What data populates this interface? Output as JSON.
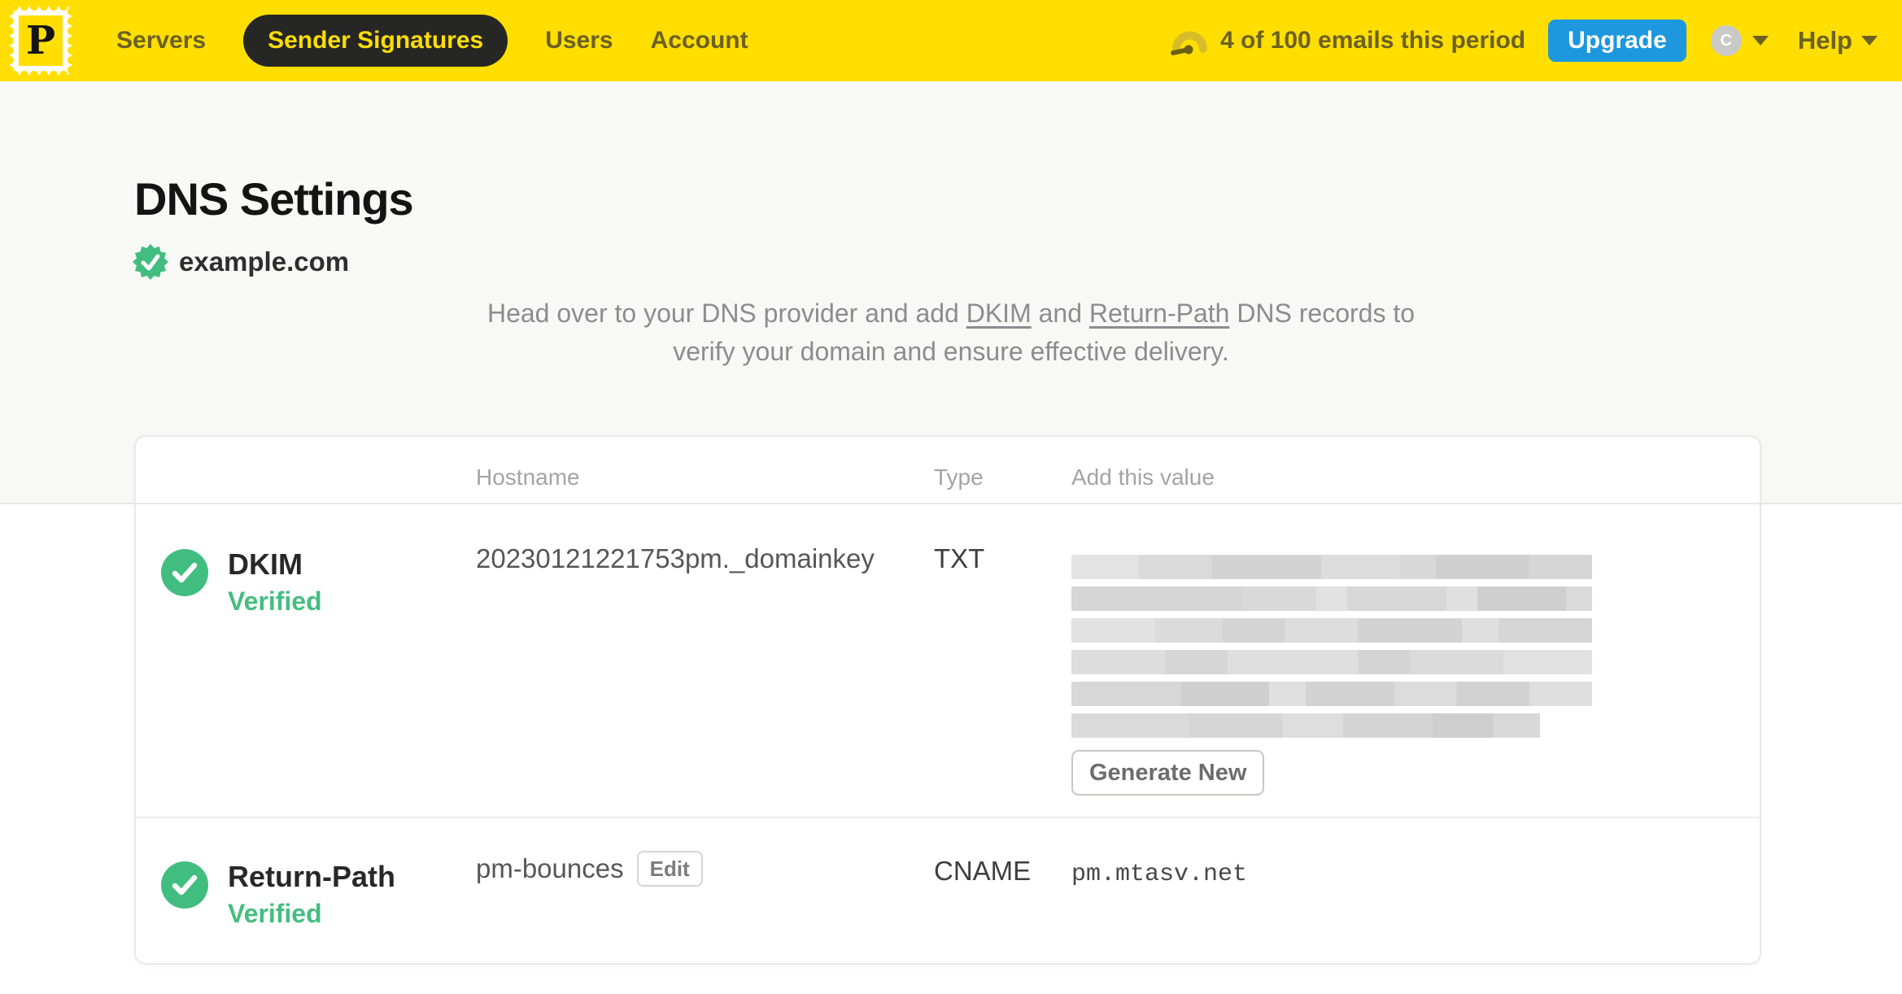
{
  "nav": {
    "logo_letter": "P",
    "items": [
      {
        "label": "Servers",
        "active": false
      },
      {
        "label": "Sender Signatures",
        "active": true
      },
      {
        "label": "Users",
        "active": false
      },
      {
        "label": "Account",
        "active": false
      }
    ],
    "usage_text": "4 of 100 emails this period",
    "upgrade_label": "Upgrade",
    "avatar_initial": "C",
    "help_label": "Help"
  },
  "page": {
    "title": "DNS Settings",
    "domain": "example.com",
    "intro": {
      "part1": "Head over to your DNS provider and add ",
      "link_dkim": "DKIM",
      "part2": " and ",
      "link_return_path": "Return-Path",
      "part3": " DNS records to",
      "part4": "verify your domain and ensure effective delivery."
    }
  },
  "table": {
    "headers": {
      "hostname": "Hostname",
      "type": "Type",
      "value": "Add this value"
    },
    "rows": [
      {
        "name": "DKIM",
        "status": "Verified",
        "hostname": "20230121221753pm._domainkey",
        "type": "TXT",
        "value_redacted": true,
        "redacted_lines": 6,
        "action_label": "Generate New"
      },
      {
        "name": "Return-Path",
        "status": "Verified",
        "hostname": "pm-bounces",
        "edit_label": "Edit",
        "type": "CNAME",
        "value": "pm.mtasv.net"
      }
    ]
  },
  "colors": {
    "brand_yellow": "#FFDE00",
    "nav_text_olive": "#6C6020",
    "active_pill_bg": "#262624",
    "upgrade_blue": "#1D97DE",
    "verified_green": "#41BD7F",
    "intro_gray": "#8C8C90"
  }
}
